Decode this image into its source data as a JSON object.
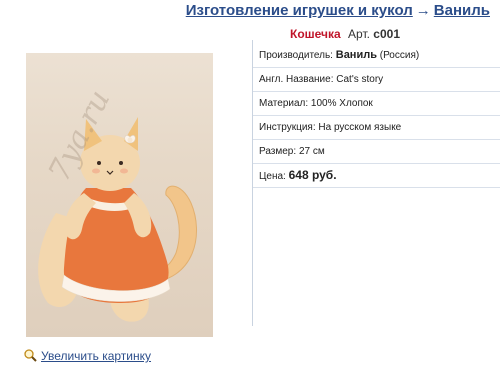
{
  "breadcrumb": {
    "category": "Изготовление игрушек и кукол",
    "arrow": "→",
    "brand": "Ваниль"
  },
  "product": {
    "name": "Кошечка",
    "article_label": "Арт.",
    "article": "c001"
  },
  "image": {
    "watermark": "7ya.ru",
    "zoom_label": "Увеличить картинку"
  },
  "specs": {
    "manufacturer_label": "Производитель:",
    "manufacturer": "Ваниль",
    "manufacturer_country": "(Россия)",
    "english_name_label": "Англ. Название:",
    "english_name": "Cat's story",
    "material_label": "Материал:",
    "material": "100% Хлопок",
    "instruction_label": "Инструкция:",
    "instruction": "На русском языке",
    "size_label": "Размер:",
    "size": "27 см",
    "price_label": "Цена:",
    "price": "648 руб."
  },
  "colors": {
    "link": "#2b4d8a",
    "product_name": "#c0152a"
  }
}
